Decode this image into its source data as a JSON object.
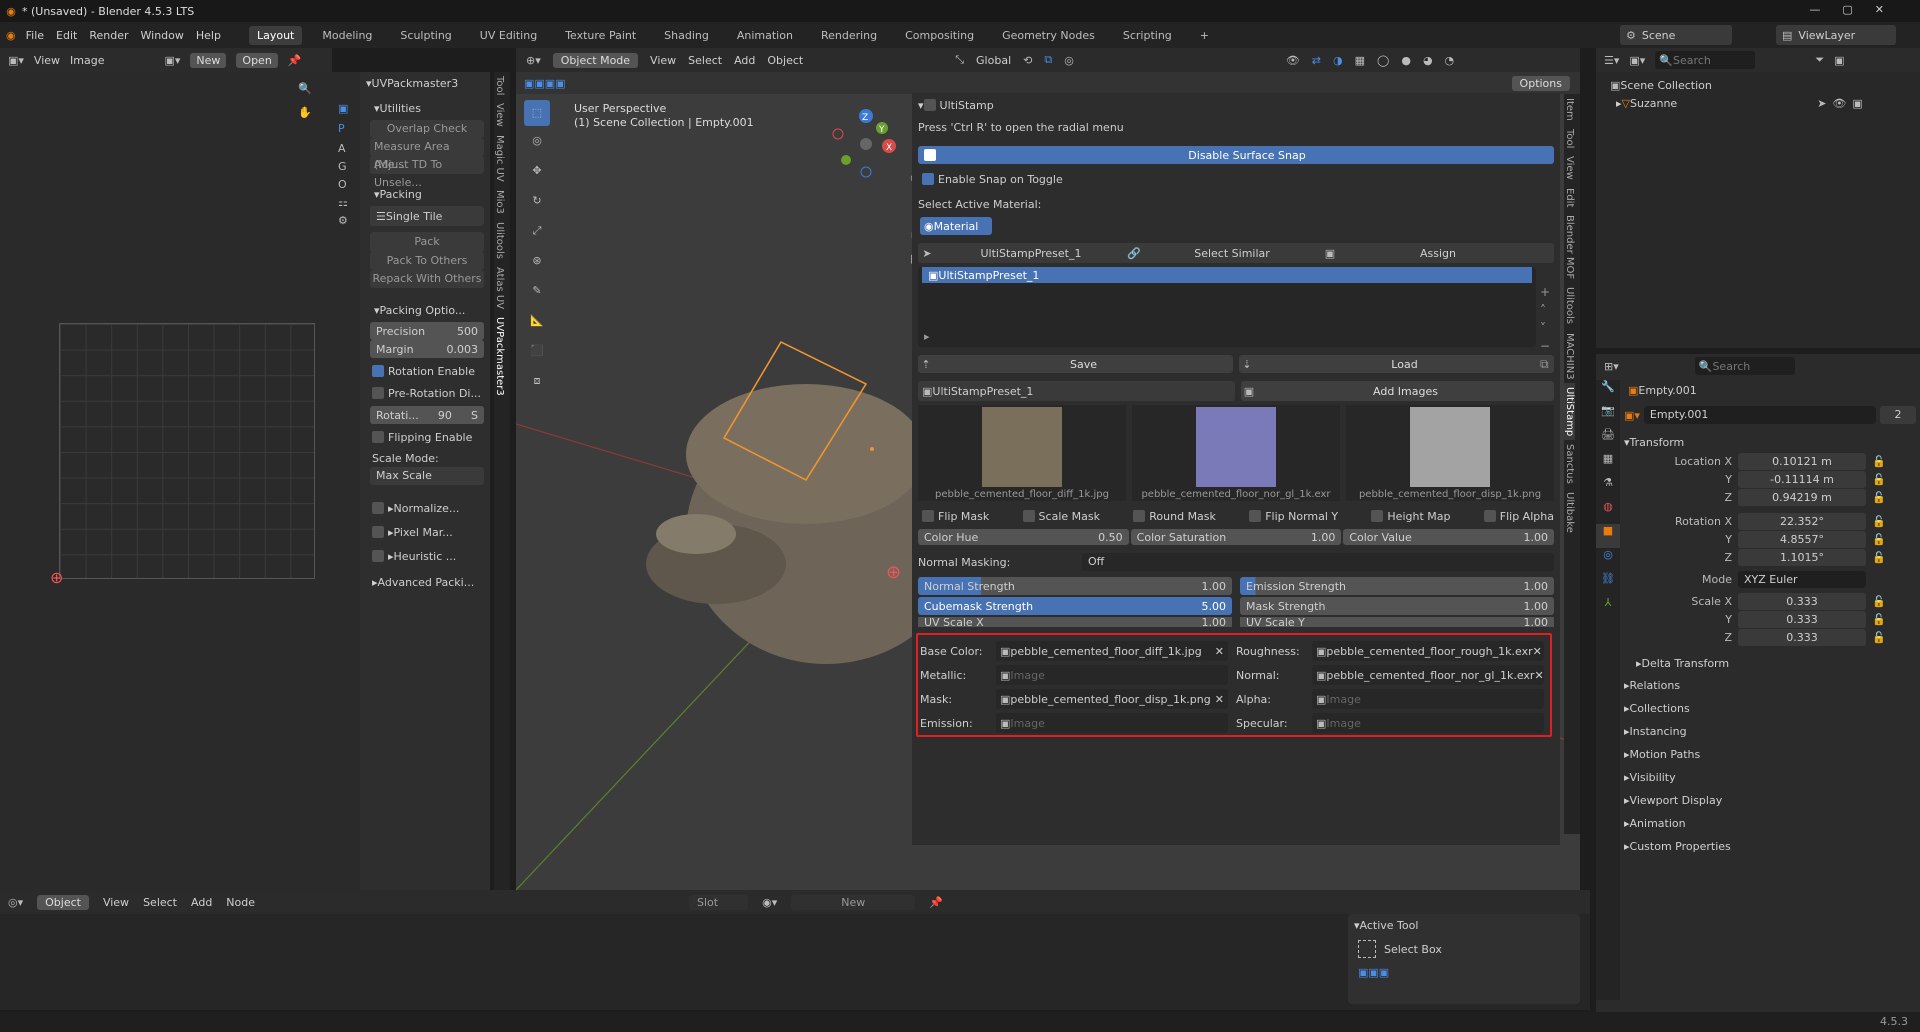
{
  "title": "* (Unsaved) - Blender 4.5.3 LTS",
  "menu": [
    "File",
    "Edit",
    "Render",
    "Window",
    "Help"
  ],
  "workspaces": [
    "Layout",
    "Modeling",
    "Sculpting",
    "UV Editing",
    "Texture Paint",
    "Shading",
    "Animation",
    "Rendering",
    "Compositing",
    "Geometry Nodes",
    "Scripting",
    "+"
  ],
  "scene": "Scene",
  "viewlayer": "ViewLayer",
  "img_hdr": {
    "view": "View",
    "image": "Image",
    "new": "New",
    "open": "Open"
  },
  "uvp": {
    "title": "UVPackmaster3",
    "utilities": "Utilities",
    "overlap": "Overlap Check",
    "measure": "Measure Area  (Me...",
    "adjust": "Adjust TD To Unsele...",
    "packing": "Packing",
    "single_tile": "Single Tile",
    "pack": "Pack",
    "pack_to_others": "Pack To Others",
    "repack": "Repack With Others",
    "packing_opts": "Packing Optio...",
    "precision_lbl": "Precision",
    "precision": "500",
    "margin_lbl": "Margin",
    "margin": "0.003",
    "rotation_enable": "Rotation Enable",
    "pre_rotation": "Pre-Rotation Di...",
    "rotati_lbl": "Rotati...",
    "rotati": "90",
    "rot_s": "S",
    "flipping": "Flipping Enable",
    "scale_mode": "Scale Mode:",
    "max_scale": "Max Scale",
    "normalize": "Normalize...",
    "pixel_mar": "Pixel Mar...",
    "heuristic": "Heuristic ...",
    "advanced": "Advanced Packi..."
  },
  "side_tabs": [
    "Tool",
    "View",
    "Magic UV",
    "Mio3",
    "Ulitools",
    "Atlas UV",
    "UVPackmaster3"
  ],
  "vp_hdr": {
    "mode": "Object Mode",
    "view": "View",
    "select": "Select",
    "add": "Add",
    "object": "Object",
    "global": "Global",
    "options": "Options"
  },
  "vp": {
    "persp": "User Perspective",
    "coll": "(1) Scene Collection | Empty.001"
  },
  "us": {
    "title": "UltiStamp",
    "hint": "Press 'Ctrl R' to open the radial menu",
    "disable_snap": "Disable Surface Snap",
    "enable_snap": "Enable Snap on Toggle",
    "sel_mat": "Select Active Material:",
    "material": "Material",
    "preset": "UltiStampPreset_1",
    "select_similar": "Select Similar",
    "assign": "Assign",
    "list_item": "UltiStampPreset_1",
    "save": "Save",
    "load": "Load",
    "preset2": "UltiStampPreset_1",
    "add_images": "Add Images",
    "thumbs": [
      {
        "name": "pebble_cemented_floor_diff_1k.jpg",
        "color": "#7a6f5a"
      },
      {
        "name": "pebble_cemented_floor_nor_gl_1k.exr",
        "color": "#7a7ab8"
      },
      {
        "name": "pebble_cemented_floor_disp_1k.png",
        "color": "#a3a3a3"
      }
    ],
    "flags": [
      "Flip Mask",
      "Scale Mask",
      "Round Mask",
      "Flip Normal Y",
      "Height Map",
      "Flip Alpha"
    ],
    "hue_lbl": "Color Hue",
    "hue": "0.50",
    "sat_lbl": "Color Saturation",
    "sat": "1.00",
    "val_lbl": "Color Value",
    "val": "1.00",
    "nm_lbl": "Normal Masking:",
    "nm": "Off",
    "ns_lbl": "Normal Strength",
    "ns": "1.00",
    "es_lbl": "Emission Strength",
    "es": "1.00",
    "cs_lbl": "Cubemask Strength",
    "cs": "5.00",
    "ms_lbl": "Mask Strength",
    "ms": "1.00",
    "uvx_lbl": "UV Scale X",
    "uvx": "1.00",
    "uvy_lbl": "UV Scale Y",
    "uvy": "1.00",
    "slots": [
      {
        "label": "Base Color:",
        "value": "pebble_cemented_floor_diff_1k.jpg"
      },
      {
        "label": "Roughness:",
        "value": "pebble_cemented_floor_rough_1k.exr"
      },
      {
        "label": "Metallic:",
        "value": "Image"
      },
      {
        "label": "Normal:",
        "value": "pebble_cemented_floor_nor_gl_1k.exr"
      },
      {
        "label": "Mask:",
        "value": "pebble_cemented_floor_disp_1k.png"
      },
      {
        "label": "Alpha:",
        "value": "Image"
      },
      {
        "label": "Emission:",
        "value": "Image"
      },
      {
        "label": "Specular:",
        "value": "Image"
      }
    ]
  },
  "vp_tabs": [
    "Item",
    "Tool",
    "View",
    "Edit",
    "Blender MOF",
    "Ulitools",
    "MACHIN3",
    "UltiStamp",
    "Sanctus",
    "Ultibake"
  ],
  "outliner": {
    "search": "Search",
    "scene_coll": "Scene Collection",
    "suzanne": "Suzanne"
  },
  "props": {
    "search": "Search",
    "obj": "Empty.001",
    "name": "Empty.001",
    "users": "2",
    "transform": "Transform",
    "loc_lbl": "Location X",
    "lx": "0.10121 m",
    "ly": "-0.11114 m",
    "lz": "0.94219 m",
    "rot_lbl": "Rotation X",
    "rx": "22.352°",
    "ry": "4.8557°",
    "rz": "1.1015°",
    "mode_lbl": "Mode",
    "mode": "XYZ Euler",
    "scale_lbl": "Scale X",
    "sx": "0.333",
    "sy": "0.333",
    "sz": "0.333",
    "y": "Y",
    "z": "Z",
    "sections": [
      "Delta Transform",
      "Relations",
      "Collections",
      "Instancing",
      "Motion Paths",
      "Visibility",
      "Viewport Display",
      "Animation",
      "Custom Properties"
    ]
  },
  "node_hdr": {
    "object": "Object",
    "view": "View",
    "select": "Select",
    "add": "Add",
    "node": "Node",
    "slot": "Slot",
    "new": "New"
  },
  "active_tool": {
    "title": "Active Tool",
    "name": "Select Box"
  },
  "version": "4.5.3"
}
